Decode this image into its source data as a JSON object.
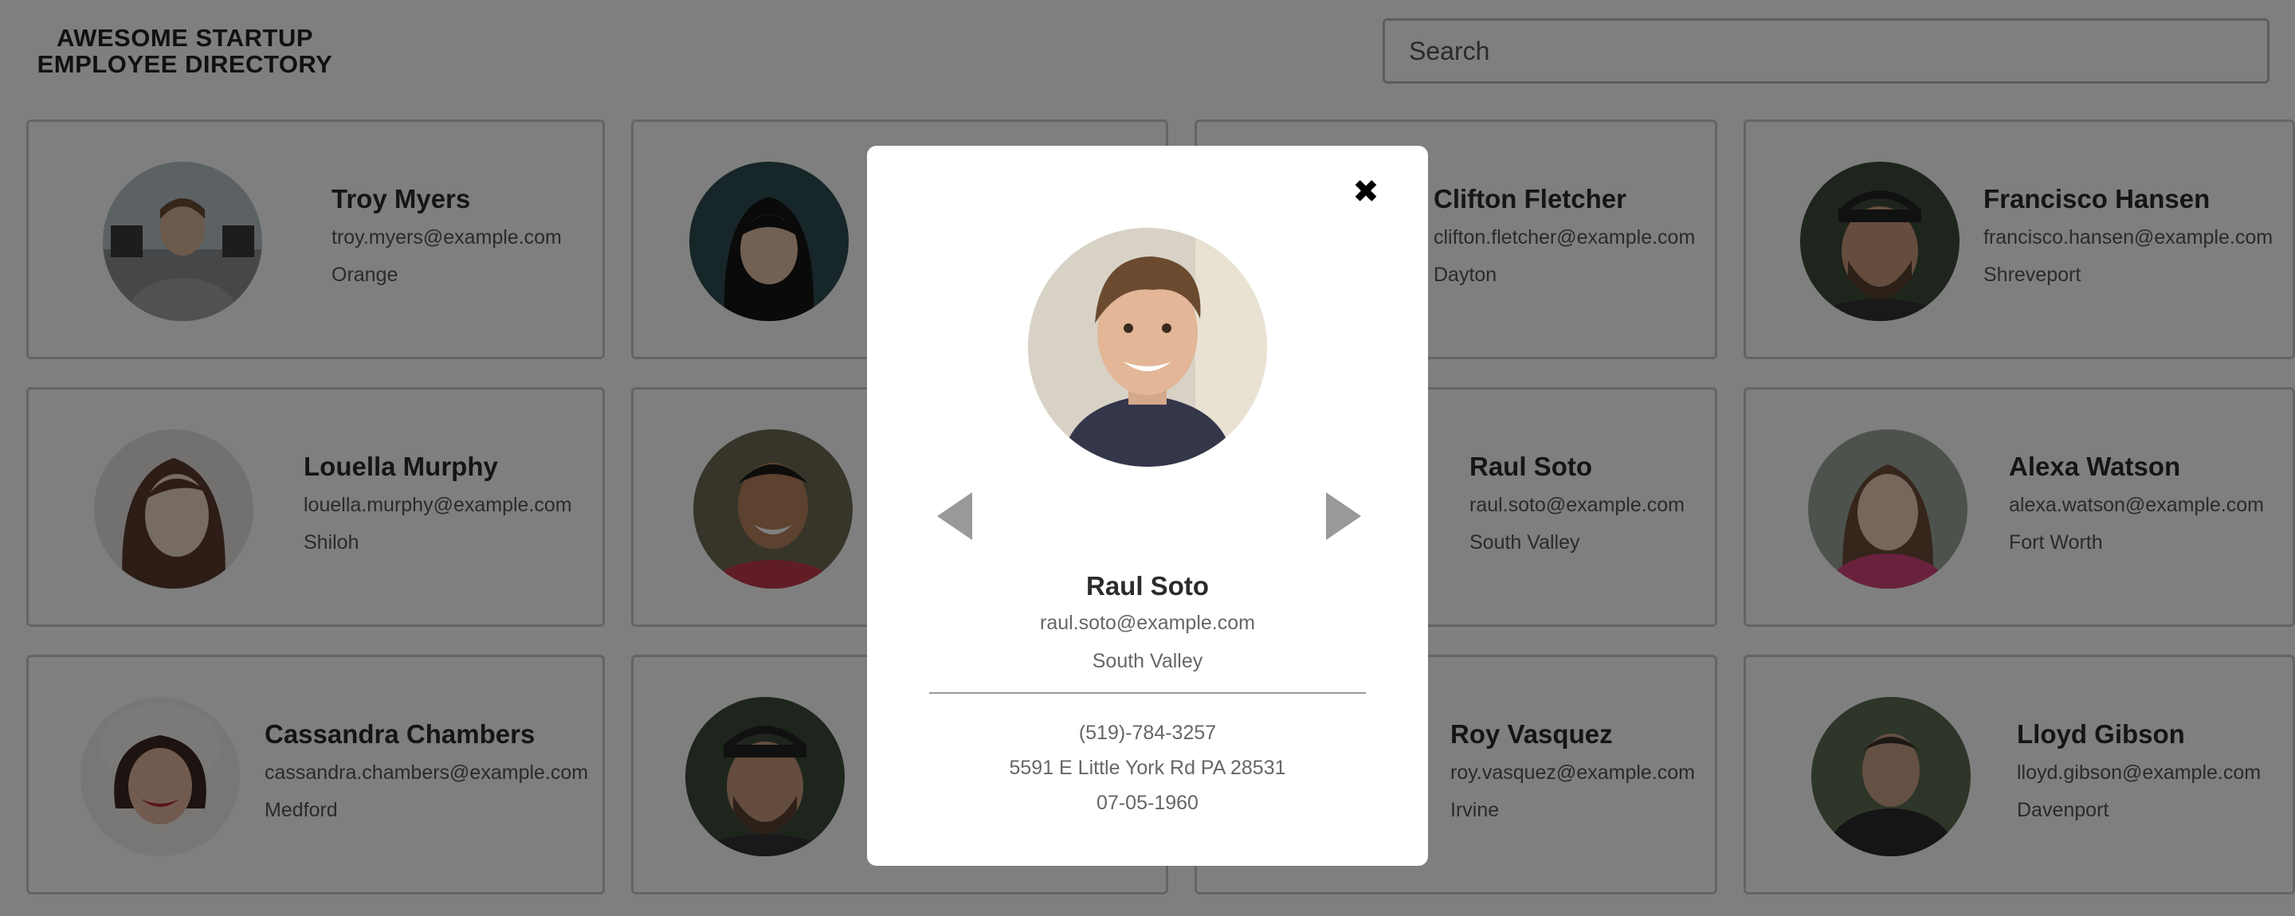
{
  "header": {
    "title_line1": "AWESOME STARTUP",
    "title_line2": "EMPLOYEE DIRECTORY",
    "search_placeholder": "Search"
  },
  "employees": [
    {
      "name": "Troy Myers",
      "email": "troy.myers@example.com",
      "city": "Orange"
    },
    {
      "name": "",
      "email": "",
      "city": ""
    },
    {
      "name": "Clifton Fletcher",
      "email": "clifton.fletcher@example.com",
      "city": "Dayton"
    },
    {
      "name": "Francisco Hansen",
      "email": "francisco.hansen@example.com",
      "city": "Shreveport"
    },
    {
      "name": "Louella Murphy",
      "email": "louella.murphy@example.com",
      "city": "Shiloh"
    },
    {
      "name": "",
      "email": "",
      "city": ""
    },
    {
      "name": "Raul Soto",
      "email": "raul.soto@example.com",
      "city": "South Valley"
    },
    {
      "name": "Alexa Watson",
      "email": "alexa.watson@example.com",
      "city": "Fort Worth"
    },
    {
      "name": "Cassandra Chambers",
      "email": "cassandra.chambers@example.com",
      "city": "Medford"
    },
    {
      "name": "",
      "email": "",
      "city": ""
    },
    {
      "name": "Roy Vasquez",
      "email": "roy.vasquez@example.com",
      "city": "Irvine"
    },
    {
      "name": "Lloyd Gibson",
      "email": "lloyd.gibson@example.com",
      "city": "Davenport"
    }
  ],
  "modal": {
    "close_label": "✖",
    "name": "Raul Soto",
    "email": "raul.soto@example.com",
    "city": "South Valley",
    "phone": "(519)-784-3257",
    "address": "5591 E Little York Rd PA 28531",
    "birthday": "07-05-1960",
    "prev_icon": "triangle-left-icon",
    "next_icon": "triangle-right-icon"
  },
  "colors": {
    "overlay": "rgba(0,0,0,0.5)",
    "card_border": "#c9c9c9",
    "arrow": "#999999"
  }
}
